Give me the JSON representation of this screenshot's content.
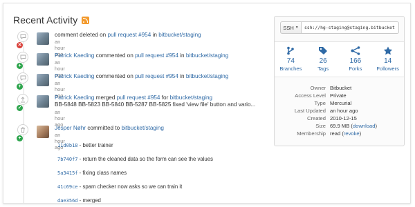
{
  "header": {
    "title": "Recent Activity",
    "rss_icon": "rss-icon"
  },
  "events": [
    {
      "text_pre": "comment deleted on ",
      "link1": "pull request #954",
      "text_mid": " in ",
      "link2": "bitbucket/staging",
      "time": "an hour ago",
      "icon": "comment-icon",
      "badge": "✕",
      "badge_color": "#d9403a"
    },
    {
      "user": "Patrick Kaeding",
      "text_mid1": " commented on ",
      "link1": "pull request #954",
      "text_mid2": " in ",
      "link2": "bitbucket/staging",
      "time": "an hour ago",
      "icon": "comment-icon",
      "badge": "+",
      "badge_color": "#2ea54d"
    },
    {
      "user": "Patrick Kaeding",
      "text_mid1": " commented on ",
      "link1": "pull request #954",
      "text_mid2": " in ",
      "link2": "bitbucket/staging",
      "time": "an hour ago",
      "icon": "comment-icon",
      "badge": "+",
      "badge_color": "#2ea54d"
    },
    {
      "user": "Patrick Kaeding",
      "text_mid1": " merged ",
      "link1": "pull request #954",
      "text_mid2": " for ",
      "link2": "bitbucket/staging",
      "detail": "BB-5848 BB-5823 BB-5840 BB-5287 BB-5825 fixed 'view file' button and vario...",
      "time": "an hour ago",
      "icon": "upload-icon",
      "badge": "✓",
      "badge_color": "#2ea54d"
    },
    {
      "user": "Jesper Nøhr",
      "text_mid1": " committed to ",
      "link1": "bitbucket/staging",
      "time": "an hour ago",
      "icon": "trash-icon",
      "badge": "+",
      "badge_color": "#2ea54d"
    }
  ],
  "commits": [
    {
      "hash": "11d0b18",
      "message": " - better trainer"
    },
    {
      "hash": "7b740f7",
      "message": " - return the cleaned data so the form can see the values"
    },
    {
      "hash": "5a3415f",
      "message": " - fixing class names"
    },
    {
      "hash": "41c69ce",
      "message": " - spam checker now asks so we can train it"
    },
    {
      "hash": "dae356d",
      "message": " - merged"
    }
  ],
  "clone": {
    "protocol": "SSH",
    "url": "ssh://hg-staging@staging.bitbucket.org/bitbucket/staging"
  },
  "stats": [
    {
      "num": "74",
      "label": "Branches",
      "icon": "branch-icon"
    },
    {
      "num": "26",
      "label": "Tags",
      "icon": "tag-icon"
    },
    {
      "num": "166",
      "label": "Forks",
      "icon": "fork-icon"
    },
    {
      "num": "14",
      "label": "Followers",
      "icon": "star-icon"
    }
  ],
  "info": {
    "owner_k": "Owner",
    "owner_v": "Bitbucket",
    "access_k": "Access Level",
    "access_v": "Private",
    "type_k": "Type",
    "type_v": "Mercurial",
    "updated_k": "Last Updated",
    "updated_v": "an hour ago",
    "created_k": "Created",
    "created_v": "2010-12-15",
    "size_k": "Size",
    "size_v": "69.9 MB",
    "size_open": " (",
    "size_link": "download",
    "size_close": ")",
    "member_k": "Membership",
    "member_v": "read",
    "member_open": " (",
    "member_link": "revoke",
    "member_close": ")"
  },
  "colors": {
    "link": "#2f6aa6",
    "rss": "#f39a2d",
    "badge_green": "#2ea54d",
    "badge_red": "#d9403a"
  }
}
